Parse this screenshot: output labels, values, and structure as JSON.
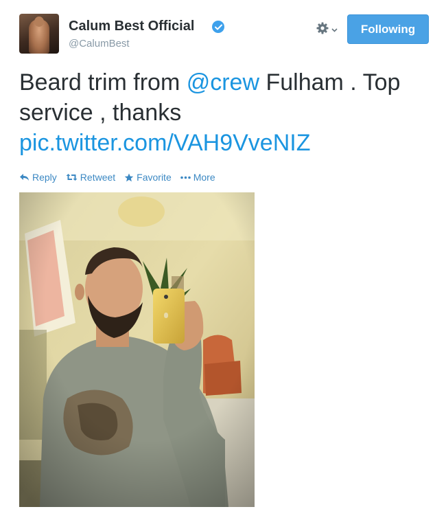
{
  "user": {
    "full_name": "Calum Best Official",
    "username": "@CalumBest",
    "verified_icon": "verified-badge-icon"
  },
  "follow_button": {
    "label": "Following"
  },
  "settings_icon": "gear-icon",
  "tweet": {
    "text_before_mention": "Beard trim from ",
    "mention": "@crew",
    "text_after_mention": " Fulham . Top service , thanks",
    "pic_link": "pic.twitter.com/VAH9VveNIZ"
  },
  "actions": [
    {
      "label": "Reply",
      "icon": "reply-icon"
    },
    {
      "label": "Retweet",
      "icon": "retweet-icon"
    },
    {
      "label": "Favorite",
      "icon": "star-icon"
    },
    {
      "label": "More",
      "icon": "more-dots-icon"
    }
  ],
  "colors": {
    "link": "#1b95e0",
    "follow_button": "#4aa2e5",
    "action": "#3b88c3",
    "verified": "#3ea1ec"
  }
}
